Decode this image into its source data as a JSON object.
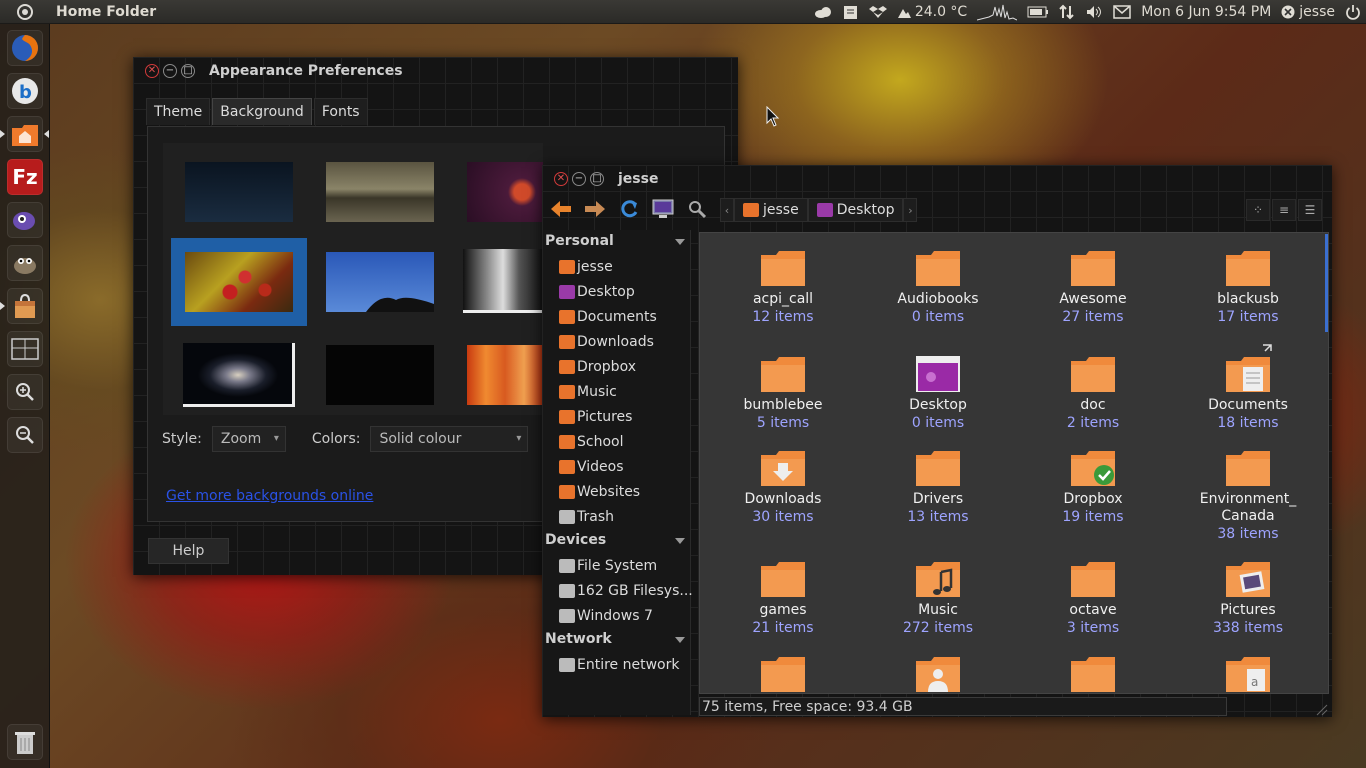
{
  "top_panel": {
    "app_title": "Home Folder",
    "weather": "24.0 °C",
    "datetime": "Mon 6 Jun 9:54 PM",
    "user": "jesse"
  },
  "launcher": {
    "items": [
      "firefox-icon",
      "bluetooth-browser-icon",
      "home-folder-icon",
      "filezilla-icon",
      "pidgin-icon",
      "gimp-icon",
      "software-center-icon",
      "workspace-switcher-icon",
      "zoom-in-icon",
      "zoom-out-icon",
      "trash-icon"
    ]
  },
  "appearance": {
    "title": "Appearance Preferences",
    "tabs": [
      "Theme",
      "Background",
      "Fonts"
    ],
    "active_tab": "Background",
    "style_label": "Style:",
    "style_value": "Zoom",
    "colors_label": "Colors:",
    "colors_value": "Solid colour",
    "more_link": "Get more backgrounds online",
    "help": "Help"
  },
  "files": {
    "title": "jesse",
    "breadcrumbs": [
      "jesse",
      "Desktop"
    ],
    "sidebar": {
      "personal_header": "Personal",
      "personal": [
        "jesse",
        "Desktop",
        "Documents",
        "Downloads",
        "Dropbox",
        "Music",
        "Pictures",
        "School",
        "Videos",
        "Websites",
        "Trash"
      ],
      "devices_header": "Devices",
      "devices": [
        "File System",
        "162 GB Filesys...",
        "Windows 7"
      ],
      "network_header": "Network",
      "network": [
        "Entire network"
      ]
    },
    "items": [
      {
        "name": "acpi_call",
        "count": "12 items"
      },
      {
        "name": "Audiobooks",
        "count": "0 items"
      },
      {
        "name": "Awesome",
        "count": "27 items"
      },
      {
        "name": "blackusb",
        "count": "17 items"
      },
      {
        "name": "bumblebee",
        "count": "5 items"
      },
      {
        "name": "Desktop",
        "count": "0 items"
      },
      {
        "name": "doc",
        "count": "2 items"
      },
      {
        "name": "Documents",
        "count": "18 items"
      },
      {
        "name": "Downloads",
        "count": "30 items"
      },
      {
        "name": "Drivers",
        "count": "13 items"
      },
      {
        "name": "Dropbox",
        "count": "19 items"
      },
      {
        "name_line1": "Environment_",
        "name_line2": "Canada",
        "count": "38 items"
      },
      {
        "name": "games",
        "count": "21 items"
      },
      {
        "name": "Music",
        "count": "272 items"
      },
      {
        "name": "octave",
        "count": "3 items"
      },
      {
        "name": "Pictures",
        "count": "338 items"
      }
    ],
    "status": "75 items, Free space: 93.4 GB"
  },
  "colors": {
    "folder_orange": "#f08a3c",
    "selection_blue": "#1f5fa6",
    "count_blue": "#9ea4ff",
    "link_blue": "#2a52e6"
  }
}
